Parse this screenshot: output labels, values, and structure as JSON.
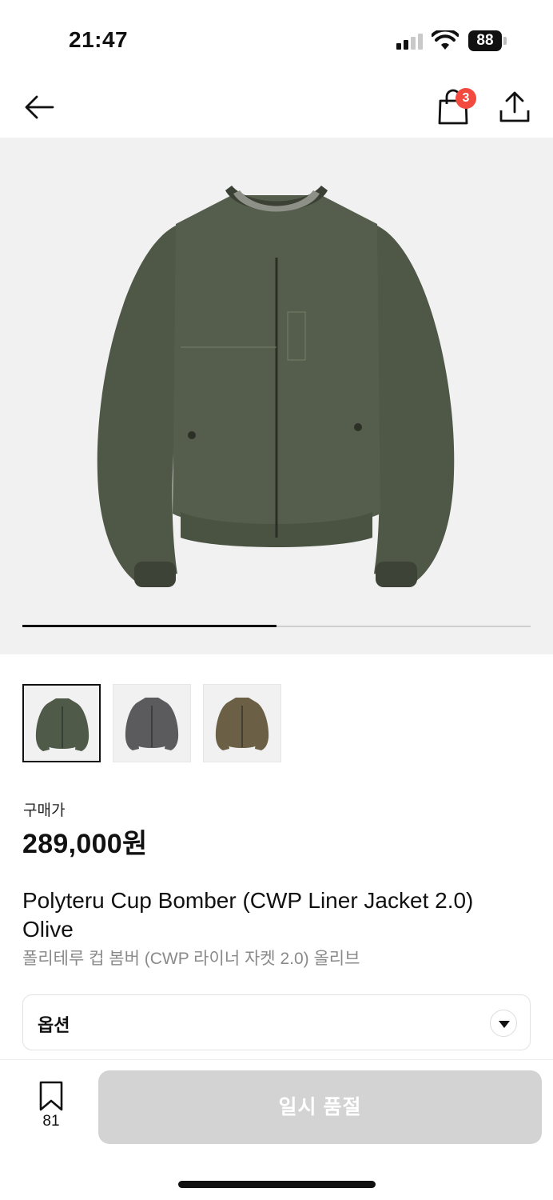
{
  "status_bar": {
    "time": "21:47",
    "battery": "88",
    "icons": [
      "cellular-signal-icon",
      "wifi-icon",
      "battery-icon"
    ]
  },
  "nav": {
    "icons": [
      "back-arrow-icon",
      "shopping-bag-icon",
      "share-icon"
    ],
    "cart_count": "3",
    "badge_color": "#f24a3e"
  },
  "gallery": {
    "current_progress": 0.5,
    "thumbnails": [
      {
        "name": "olive",
        "color": "#505a48",
        "selected": true
      },
      {
        "name": "gray",
        "color": "#5b5b5e",
        "selected": false
      },
      {
        "name": "brown",
        "color": "#6b5f45",
        "selected": false
      }
    ]
  },
  "product": {
    "price_label": "구매가",
    "price": "289,000원",
    "title_en": "Polyteru Cup Bomber (CWP Liner Jacket 2.0) Olive",
    "title_ko": "폴리테루 컵 봄버 (CWP 라이너 자켓 2.0) 올리브"
  },
  "option": {
    "label": "옵션",
    "icon": "dropdown-arrow-icon"
  },
  "bottom_bar": {
    "bookmark_icon": "bookmark-icon",
    "bookmark_count": "81",
    "cta_label": "일시 품절",
    "cta_color": "#d3d3d3"
  }
}
